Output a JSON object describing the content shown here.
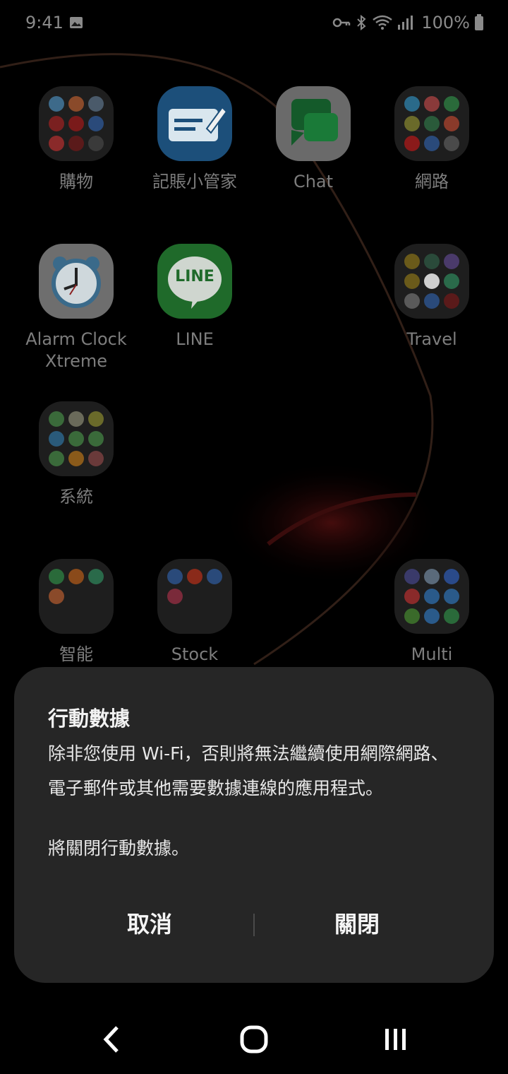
{
  "status_bar": {
    "time": "9:41",
    "battery": "100%"
  },
  "apps": [
    {
      "label": "購物"
    },
    {
      "label": "記賬小管家"
    },
    {
      "label": "Chat"
    },
    {
      "label": "網路"
    },
    {
      "label": "Alarm Clock Xtreme"
    },
    {
      "label": "LINE"
    },
    {
      "label": "Travel"
    },
    {
      "label": "系統"
    },
    {
      "label": "智能"
    },
    {
      "label": "Stock"
    },
    {
      "label": "Multi"
    }
  ],
  "icon_text": {
    "line": "LINE"
  },
  "dialog": {
    "title": "行動數據",
    "message": "除非您使用 Wi-Fi，否則將無法繼續使用網際網路、電子郵件或其他需要數據連線的應用程式。",
    "message2": "將關閉行動數據。",
    "cancel_label": "取消",
    "confirm_label": "關閉"
  },
  "colors": {
    "dialog_bg": "#262626",
    "label_gray": "#7d7d7d"
  }
}
